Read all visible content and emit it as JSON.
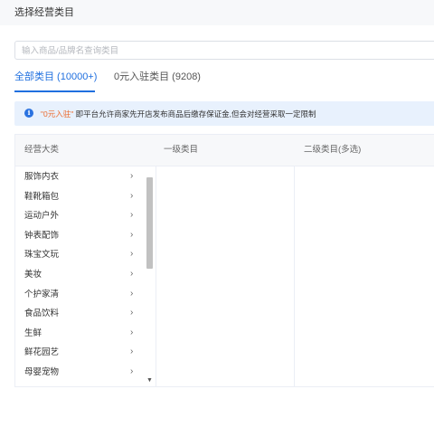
{
  "header": {
    "title": "选择经营类目"
  },
  "search": {
    "placeholder": "输入商品/品牌名查询类目",
    "value": ""
  },
  "tabs": [
    {
      "label": "全部类目 (10000+)",
      "active": true
    },
    {
      "label": "0元入驻类目 (9208)",
      "active": false
    }
  ],
  "notice": {
    "icon": "info-icon",
    "highlight": "\"0元入驻\"",
    "text": "即平台允许商家先开店发布商品后缴存保证金,但会对经营采取一定限制"
  },
  "table": {
    "columns": [
      "经营大类",
      "一级类目",
      "二级类目(多选)"
    ],
    "categories": [
      "服饰内衣",
      "鞋靴箱包",
      "运动户外",
      "钟表配饰",
      "珠宝文玩",
      "美妆",
      "个护家清",
      "食品饮料",
      "生鲜",
      "鲜花园艺",
      "母婴宠物"
    ]
  },
  "colors": {
    "accent": "#1f6fdf",
    "notice_bg": "#e8f1fd",
    "highlight": "#ec6a2c",
    "header_bg": "#f7f8fa"
  }
}
